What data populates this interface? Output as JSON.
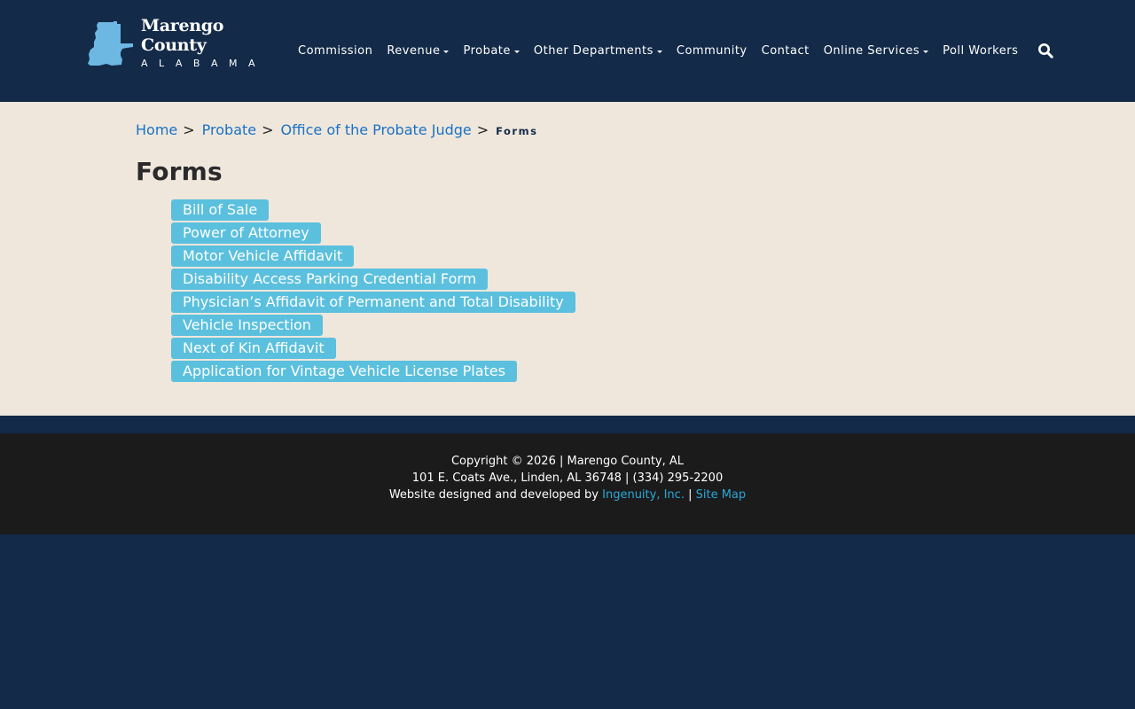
{
  "header": {
    "logo_title": "Marengo County",
    "logo_subtitle": "ALABAMA",
    "nav": [
      {
        "label": "Commission",
        "dropdown": false
      },
      {
        "label": "Revenue",
        "dropdown": true
      },
      {
        "label": "Probate",
        "dropdown": true
      },
      {
        "label": "Other Departments",
        "dropdown": true
      },
      {
        "label": "Community",
        "dropdown": false
      },
      {
        "label": "Contact",
        "dropdown": false
      },
      {
        "label": "Online Services",
        "dropdown": true
      },
      {
        "label": "Poll Workers",
        "dropdown": false
      }
    ],
    "search_icon": "search-icon"
  },
  "breadcrumb": {
    "home": "Home",
    "probate": "Probate",
    "office": "Office of the Probate Judge",
    "current": "Forms",
    "separator": ">"
  },
  "page": {
    "title": "Forms"
  },
  "forms": [
    "Bill of Sale",
    "Power of Attorney",
    "Motor Vehicle Affidavit",
    "Disability Access Parking Credential Form",
    "Physician’s Affidavit of Permanent and Total Disability",
    "Vehicle Inspection",
    "Next of Kin Affidavit",
    "Application for Vintage Vehicle License Plates"
  ],
  "footer": {
    "copyright": "Copyright © 2026 | Marengo County, AL",
    "address": "101 E. Coats Ave., Linden, AL 36748 | (334) 295-2200",
    "credit_prefix": "Website designed and developed by",
    "developer": "Ingenuity, Inc.",
    "divider": "|",
    "sitemap": "Site Map"
  },
  "colors": {
    "navy": "#132a48",
    "cream": "#efe7dc",
    "button": "#5bc0de",
    "link": "#1a72c5",
    "footer": "#1b1b1b"
  }
}
